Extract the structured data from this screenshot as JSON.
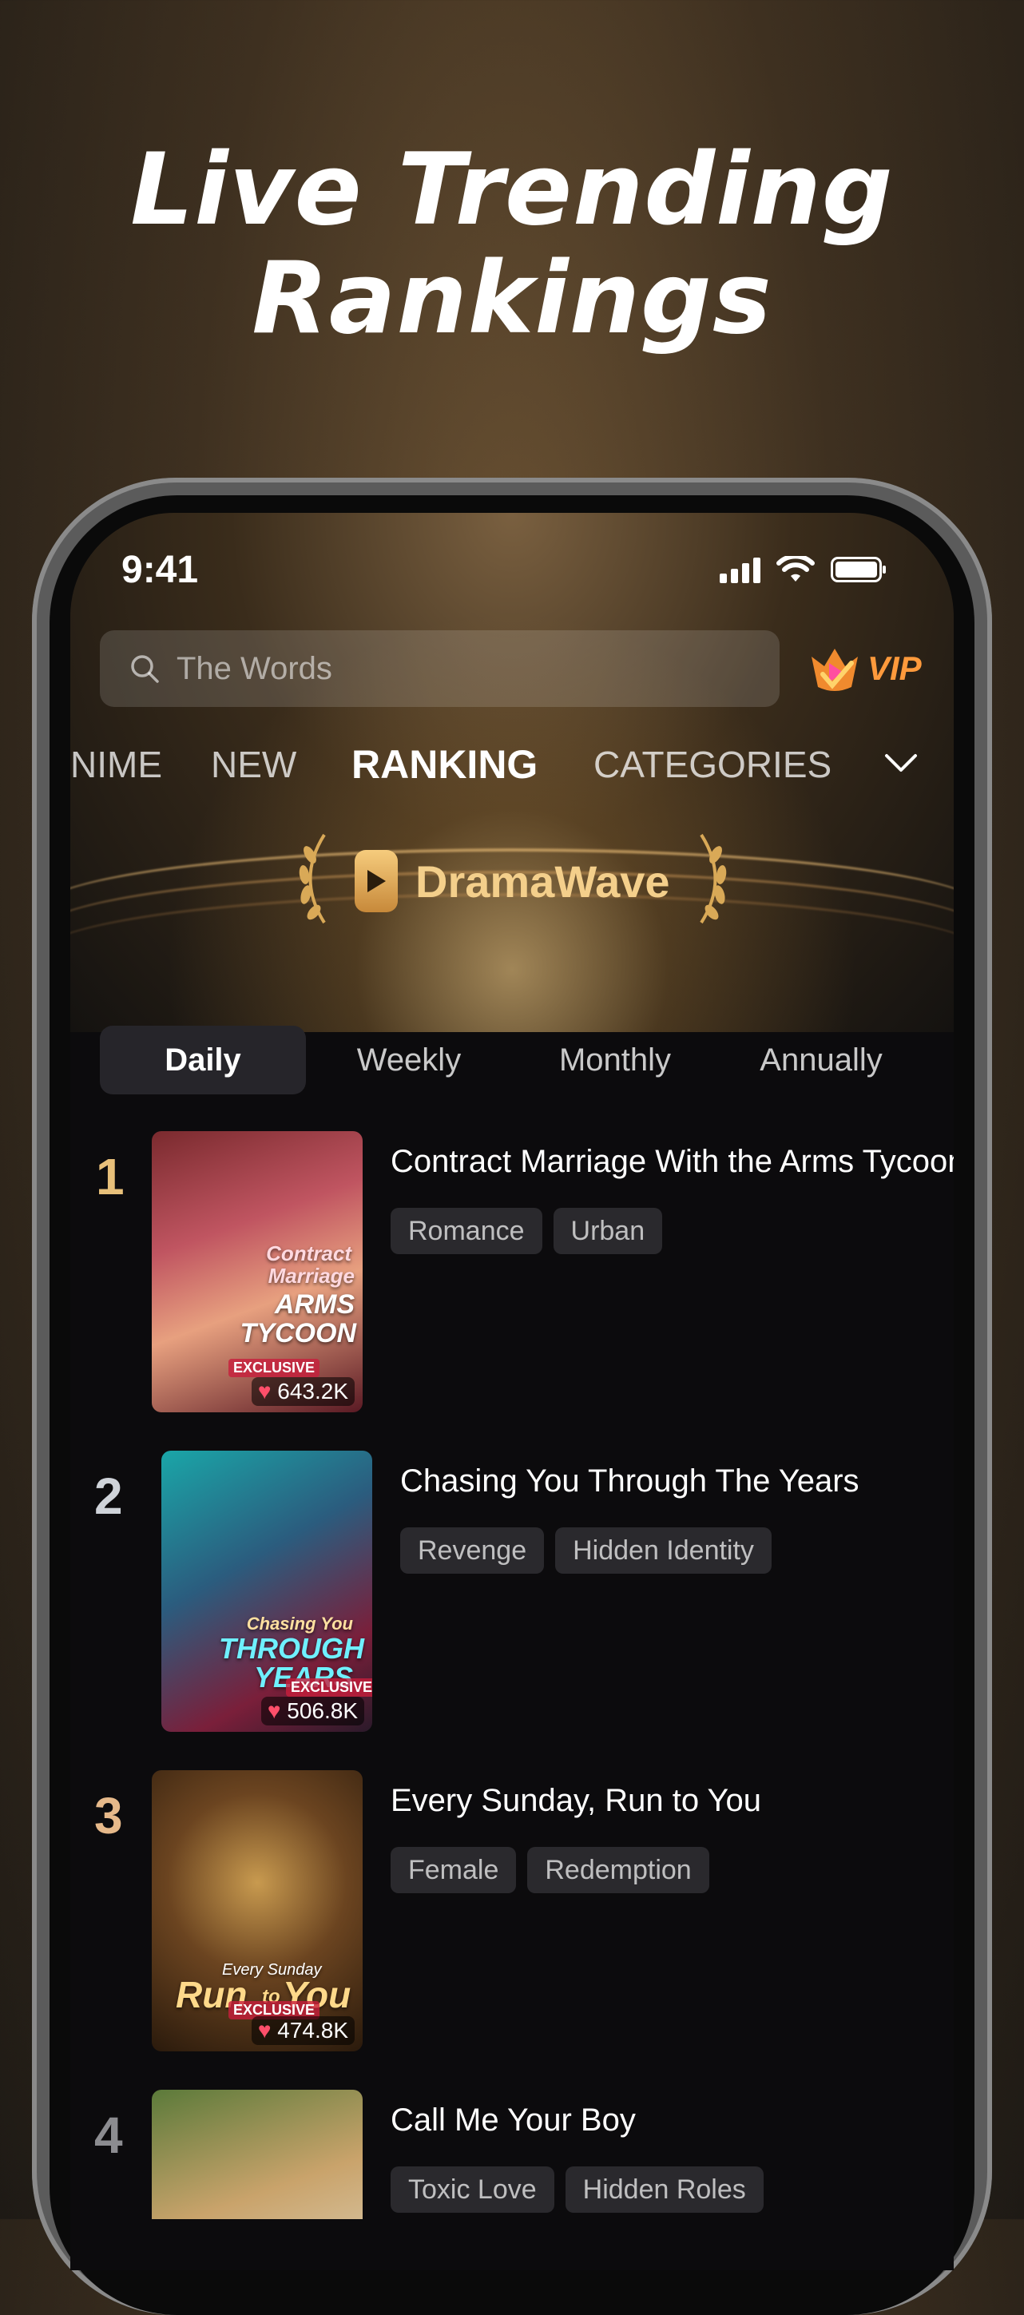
{
  "headline": {
    "line1": "Live Trending",
    "line2": "Rankings"
  },
  "status_bar": {
    "time": "9:41"
  },
  "search": {
    "placeholder": "The Words"
  },
  "vip": {
    "label": "VIP"
  },
  "top_tabs": [
    {
      "label": "NIME"
    },
    {
      "label": "NEW"
    },
    {
      "label": "RANKING",
      "active": true
    },
    {
      "label": "CATEGORIES"
    }
  ],
  "brand": {
    "name": "DramaWave"
  },
  "period_tabs": [
    {
      "label": "Daily",
      "active": true
    },
    {
      "label": "Weekly"
    },
    {
      "label": "Monthly"
    },
    {
      "label": "Annually"
    }
  ],
  "rankings": [
    {
      "rank": "1",
      "title": "Contract Marriage With the Arms Tycoon",
      "tags": [
        "Romance",
        "Urban"
      ],
      "views": "643.2K",
      "poster_text": [
        "Contract",
        "Marriage",
        "ARMS",
        "TYCOON"
      ],
      "exclusive": "EXCLUSIVE"
    },
    {
      "rank": "2",
      "title": "Chasing You Through The Years",
      "tags": [
        "Revenge",
        "Hidden Identity"
      ],
      "views": "506.8K",
      "poster_text": [
        "Chasing You",
        "THROUGH",
        "YEARS"
      ],
      "exclusive": "EXCLUSIVE"
    },
    {
      "rank": "3",
      "title": "Every Sunday, Run to You",
      "tags": [
        "Female",
        "Redemption"
      ],
      "views": "474.8K",
      "poster_text": [
        "Every Sunday",
        "Run",
        "to",
        "You"
      ],
      "exclusive": "EXCLUSIVE"
    },
    {
      "rank": "4",
      "title": "Call Me Your Boy",
      "tags": [
        "Toxic Love",
        "Hidden Roles"
      ]
    }
  ],
  "colors": {
    "accent_gold": "#e8c07a",
    "vip_orange": "#ff9a3c",
    "chip_bg": "#2a292d"
  }
}
